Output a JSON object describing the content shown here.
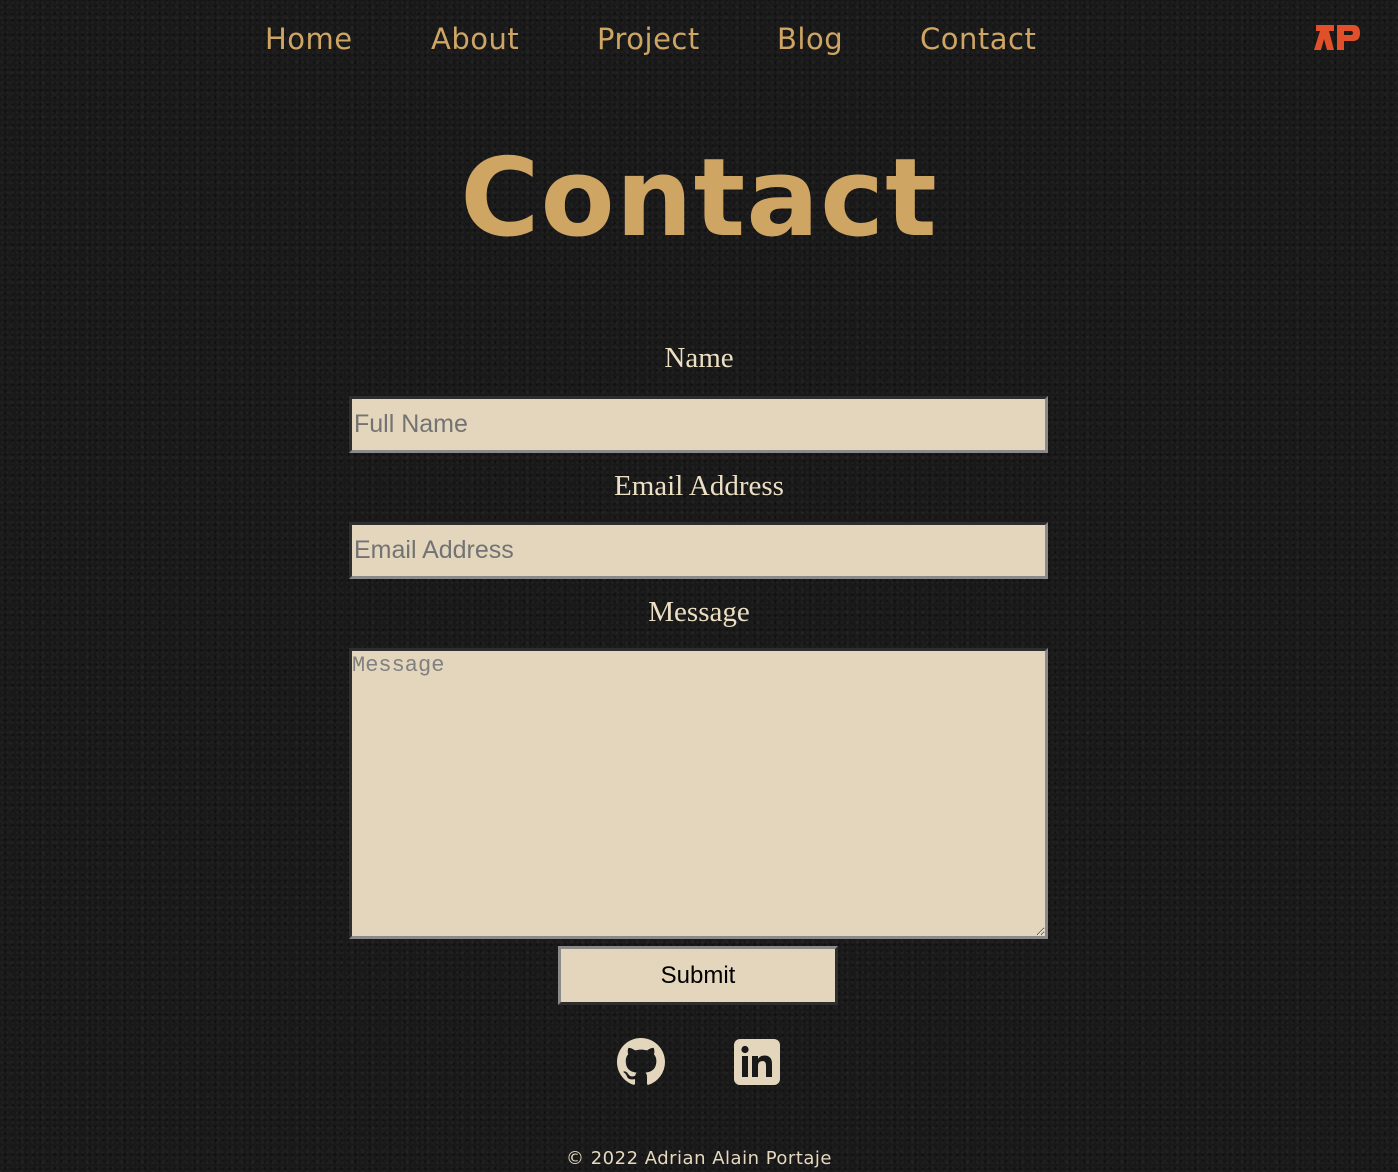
{
  "nav": {
    "items": [
      {
        "label": "Home"
      },
      {
        "label": "About"
      },
      {
        "label": "Project"
      },
      {
        "label": "Blog"
      },
      {
        "label": "Contact"
      }
    ],
    "logo_text": "AP",
    "logo_icon": "ap-monogram-logo"
  },
  "main": {
    "title": "Contact"
  },
  "form": {
    "name_label": "Name",
    "name_placeholder": "Full Name",
    "name_value": "",
    "email_label": "Email Address",
    "email_placeholder": "Email Address",
    "email_value": "",
    "message_label": "Message",
    "message_placeholder": "Message",
    "message_value": "",
    "submit_label": "Submit"
  },
  "social": {
    "items": [
      {
        "icon": "github-icon"
      },
      {
        "icon": "linkedin-icon"
      }
    ]
  },
  "footer": {
    "text": "© 2022 Adrian Alain Portaje"
  },
  "colors": {
    "background": "#191919",
    "accent": "#cfa564",
    "field_bg": "#e3d6bc",
    "label_text": "#ecdfc4",
    "logo": "#e2502a"
  }
}
